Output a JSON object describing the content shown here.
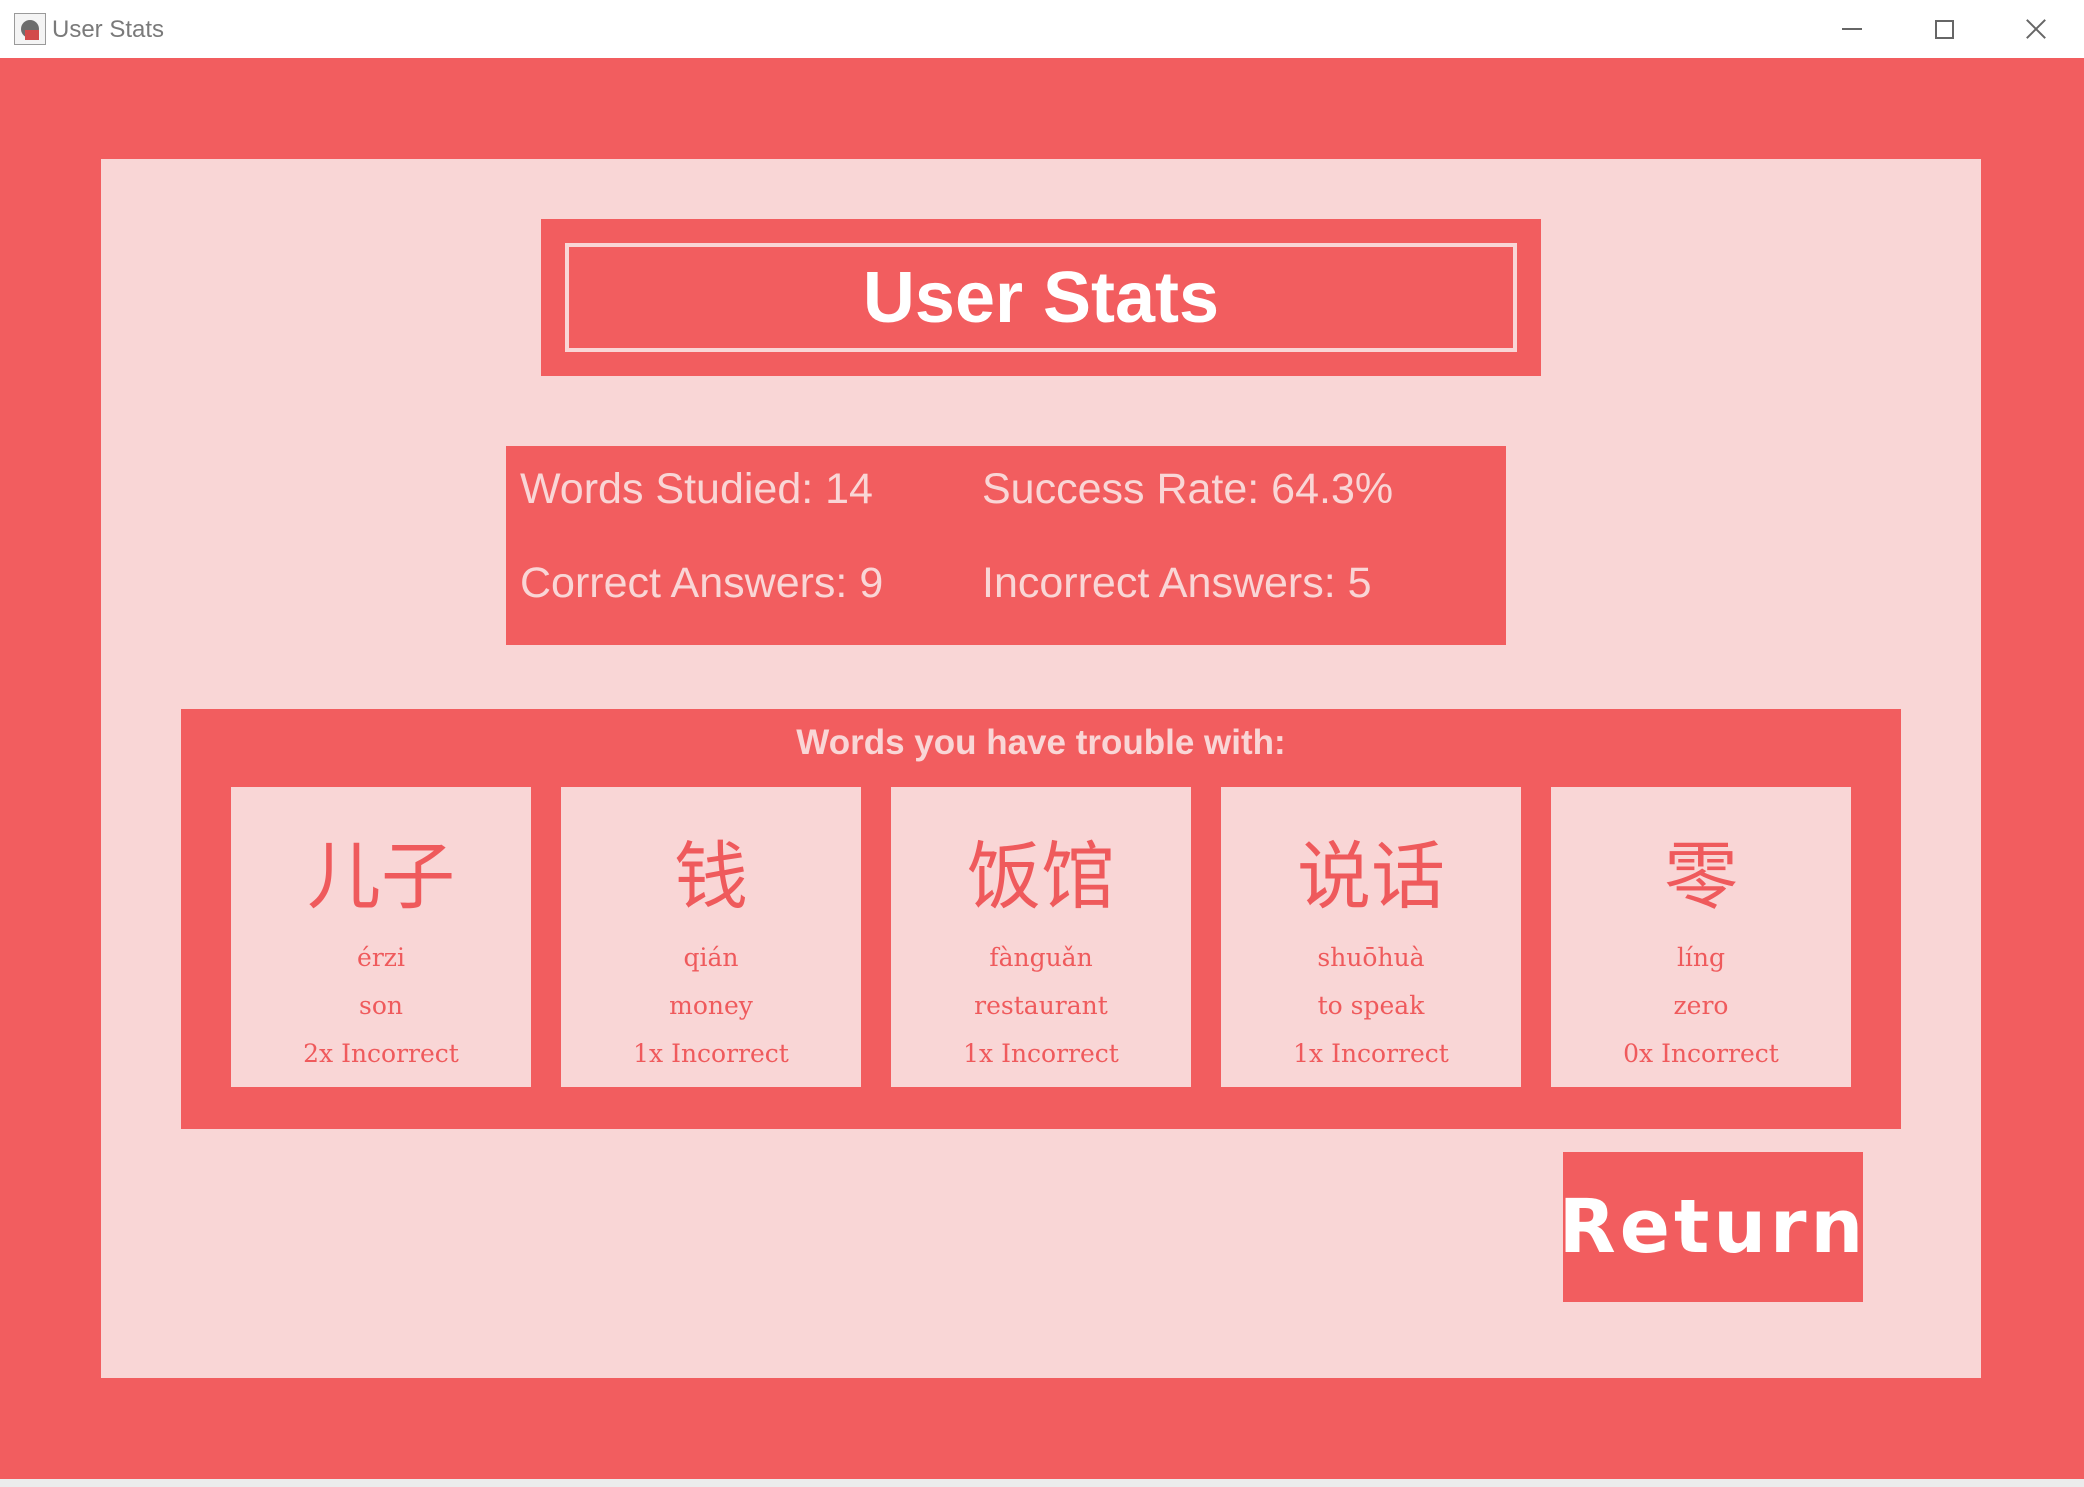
{
  "window": {
    "title": "User Stats"
  },
  "colors": {
    "accent": "#f25d5f",
    "panel": "#f9d6d6",
    "text_light": "#ffffff"
  },
  "header": {
    "title": "User Stats"
  },
  "stats": {
    "words_studied": "Words Studied: 14",
    "success_rate": "Success Rate: 64.3%",
    "correct_answers": "Correct Answers: 9",
    "incorrect_answers": "Incorrect Answers: 5"
  },
  "trouble": {
    "heading": "Words you have trouble with:",
    "words": [
      {
        "hanzi": "儿子",
        "pinyin": "érzi",
        "english": "son",
        "incorrect": "2x Incorrect"
      },
      {
        "hanzi": "钱",
        "pinyin": "qián",
        "english": "money",
        "incorrect": "1x Incorrect"
      },
      {
        "hanzi": "饭馆",
        "pinyin": "fànguǎn",
        "english": "restaurant",
        "incorrect": "1x Incorrect"
      },
      {
        "hanzi": "说话",
        "pinyin": "shuōhuà",
        "english": "to speak",
        "incorrect": "1x Incorrect"
      },
      {
        "hanzi": "零",
        "pinyin": "líng",
        "english": "zero",
        "incorrect": "0x Incorrect"
      }
    ]
  },
  "actions": {
    "return_label": "Return"
  }
}
